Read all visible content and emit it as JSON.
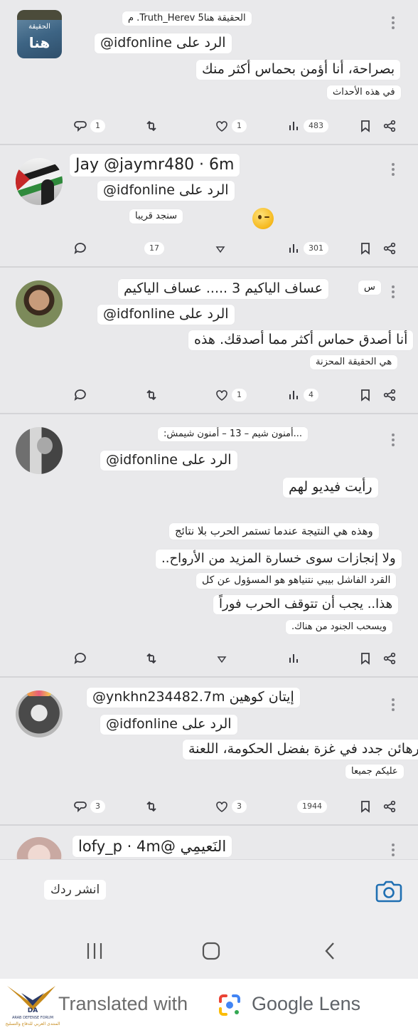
{
  "colors": {
    "background": "#e9e9eb",
    "chip": "#ffffff",
    "icon": "#3a3a40",
    "camera": "#1f6fb2"
  },
  "tweets": [
    {
      "avatar_label": [
        "الحقيقة",
        "هنا"
      ],
      "header": "الحقيقة هنا5 Truth_Herev. م",
      "reply_to": "الرد على idfonline@",
      "lines": [
        "بصراحة، أنا أؤمن بحماس أكثر منك",
        "في هذه الأحداث"
      ],
      "reply_count": "1",
      "like_count": "1",
      "views": "483"
    },
    {
      "header": "Jay @jaymr480 · 6m",
      "reply_to": "الرد على idfonline@",
      "lines": [
        "سنجد قريبا"
      ],
      "emoji": "winking-face",
      "like_count": "17",
      "views": "301"
    },
    {
      "tag": "س",
      "header": "عساف الياكيم 3 ..... عساف الياكيم",
      "reply_to": "الرد على idfonline@",
      "lines": [
        "أنا أصدق حماس أكثر مما أصدقك. هذه",
        "هي الحقيقة المحزنة"
      ],
      "like_count": "1",
      "views": "4"
    },
    {
      "header": "...أمنون شيم – 13 – أمنون شيمش:",
      "reply_to": "الرد على idfonline@",
      "lines": [
        "رأيت فيديو لهم",
        "وهذه هي النتيجة عندما تستمر الحرب بلا نتائج",
        "ولا إنجازات سوى خسارة المزيد من الأرواح..",
        "القرد الفاشل بيبي نتنياهو هو المسؤول عن كل",
        "هذا.. يجب أن تتوقف الحرب فوراً",
        "ويسحب الجنود من هناك."
      ]
    },
    {
      "header": "إيتان كوهين ynkhn234482.7m@",
      "reply_to": "الرد على idfonline@",
      "lines": [
        "رهائن جدد في غزة بفضل الحكومة، اللعنة",
        "عليكم جميعا"
      ],
      "reply_count": "3",
      "like_count": "3",
      "views": "1944"
    },
    {
      "header": "النَعيمِي @lofy_p · 4m"
    }
  ],
  "compose": {
    "placeholder": "انشر ردك",
    "icon": "camera-icon"
  },
  "navbar": {
    "icons": [
      "recent-apps-icon",
      "home-icon",
      "back-icon"
    ]
  },
  "lens": {
    "logo_text_top": "DA",
    "logo_text_1": "ARAB DEFENSE FORUM",
    "logo_text_2": "المنتدى العربي للدفاع والتسليح",
    "text_prefix": "Translated with",
    "brand": "Google Lens"
  }
}
